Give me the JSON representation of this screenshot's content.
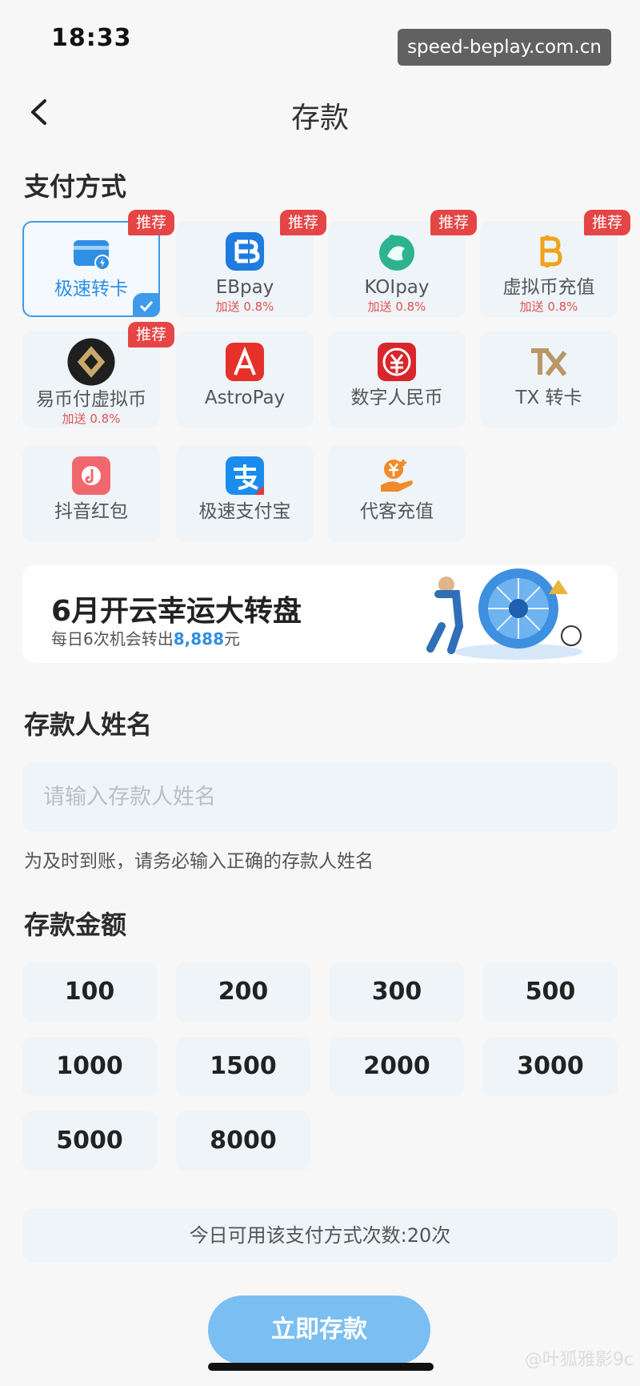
{
  "status_bar": {
    "time": "18:33",
    "watermark": "speed-beplay.com.cn"
  },
  "header": {
    "title": "存款"
  },
  "payment": {
    "section_title": "支付方式",
    "recommend_label": "推荐",
    "items": [
      {
        "label": "极速转卡",
        "bonus": "",
        "icon": "card-transfer-icon"
      },
      {
        "label": "EBpay",
        "bonus": "加送 0.8%",
        "icon": "ebpay-icon"
      },
      {
        "label": "KOIpay",
        "bonus": "加送 0.8%",
        "icon": "koipay-icon"
      },
      {
        "label": "虚拟币充值",
        "bonus": "加送 0.8%",
        "icon": "bitcoin-icon"
      },
      {
        "label": "易币付虚拟币",
        "bonus": "加送 0.8%",
        "icon": "yibifu-icon"
      },
      {
        "label": "AstroPay",
        "bonus": "",
        "icon": "astropay-icon"
      },
      {
        "label": "数字人民币",
        "bonus": "",
        "icon": "digital-rmb-icon"
      },
      {
        "label": "TX 转卡",
        "bonus": "",
        "icon": "tx-icon"
      },
      {
        "label": "抖音红包",
        "bonus": "",
        "icon": "douyin-redpacket-icon"
      },
      {
        "label": "极速支付宝",
        "bonus": "",
        "icon": "alipay-icon"
      },
      {
        "label": "代客充值",
        "bonus": "",
        "icon": "agent-recharge-icon"
      }
    ]
  },
  "banner": {
    "title": "6月开云幸运大转盘",
    "subtitle_prefix": "每日6次机会转出",
    "subtitle_amount": "8,888",
    "subtitle_suffix": "元"
  },
  "name_section": {
    "title": "存款人姓名",
    "placeholder": "请输入存款人姓名",
    "hint": "为及时到账，请务必输入正确的存款人姓名"
  },
  "amount_section": {
    "title": "存款金额",
    "amounts": [
      "100",
      "200",
      "300",
      "500",
      "1000",
      "1500",
      "2000",
      "3000",
      "5000",
      "8000"
    ]
  },
  "quota_text": "今日可用该支付方式次数:20次",
  "submit_label": "立即存款",
  "footer_watermark": "@叶狐雅影9c"
}
